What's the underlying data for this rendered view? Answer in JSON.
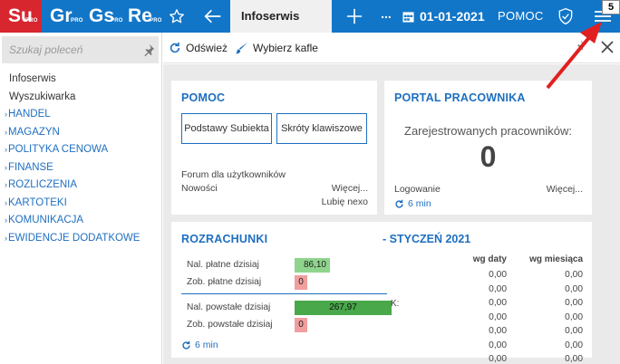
{
  "apps": [
    {
      "abbr": "Su",
      "super": "PRO"
    },
    {
      "abbr": "Gr",
      "super": "PRO"
    },
    {
      "abbr": "Gs",
      "super": "PRO"
    },
    {
      "abbr": "Re",
      "super": "PRO"
    }
  ],
  "header": {
    "active_tab": "Infoserwis",
    "more": "...",
    "date": "01-01-2021",
    "help": "POMOC",
    "badge": "5",
    "colors": {
      "bar": "#1276c8",
      "su": "#d8262f"
    }
  },
  "sidebar": {
    "search_placeholder": "Szukaj poleceń",
    "items": [
      {
        "label": "Infoserwis"
      },
      {
        "label": "Wyszukiwarka"
      },
      {
        "label": "HANDEL"
      },
      {
        "label": "MAGAZYN"
      },
      {
        "label": "POLITYKA CENOWA"
      },
      {
        "label": "FINANSE"
      },
      {
        "label": "ROZLICZENIA"
      },
      {
        "label": "KARTOTEKI"
      },
      {
        "label": "KOMUNIKACJA"
      },
      {
        "label": "EWIDENCJE DODATKOWE"
      }
    ]
  },
  "toolbar": {
    "refresh": "Odśwież",
    "tiles": "Wybierz kafle"
  },
  "pomoc": {
    "title": "POMOC",
    "btn1": "Podstawy Subiekta",
    "btn2": "Skróty klawiszowe",
    "forum": "Forum dla użytkowników",
    "news": "Nowości",
    "more": "Więcej...",
    "like": "Lubię nexo"
  },
  "portal": {
    "title": "PORTAL PRACOWNIKA",
    "registered": "Zarejestrowanych pracowników:",
    "count": "0",
    "logins": "Logowanie",
    "more": "Więcej...",
    "refresh": "6 min"
  },
  "rozrachunki": {
    "title": "ROZRACHUNKI",
    "month": "- STYCZEŃ 2021",
    "rows": [
      {
        "label": "Nal. płatne dzisiaj",
        "value": "86,10"
      },
      {
        "label": "Zob. płatne dzisiaj",
        "value": "0"
      },
      {
        "label": "Nal. powstałe dzisiaj",
        "value": "267,97"
      },
      {
        "label": "Zob. powstałe dzisiaj",
        "value": "0"
      }
    ],
    "truncated": "K:",
    "col1": "wg daty",
    "col2": "wg miesiąca",
    "col1_values": [
      "0,00",
      "0,00",
      "0,00",
      "0,00",
      "0,00",
      "0,00",
      "0,00"
    ],
    "col2_values": [
      "0,00",
      "0,00",
      "0,00",
      "0,00",
      "0,00",
      "0,00",
      "0,00"
    ],
    "refresh": "6 min"
  }
}
